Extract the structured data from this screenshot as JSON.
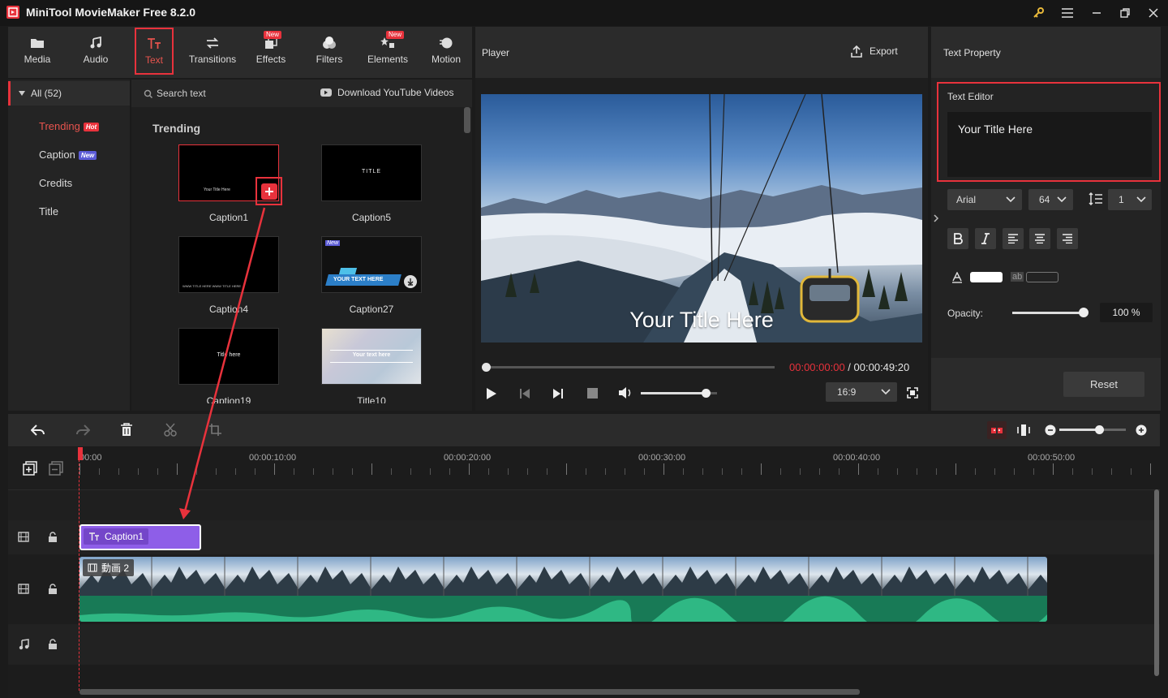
{
  "app": {
    "title": "MiniTool MovieMaker Free 8.2.0"
  },
  "toolbar": {
    "tabs": [
      {
        "label": "Media"
      },
      {
        "label": "Audio"
      },
      {
        "label": "Text"
      },
      {
        "label": "Transitions"
      },
      {
        "label": "Effects",
        "tag": "New"
      },
      {
        "label": "Filters"
      },
      {
        "label": "Elements",
        "tag": "New"
      },
      {
        "label": "Motion"
      }
    ]
  },
  "categories": {
    "all": "All (52)",
    "items": [
      {
        "label": "Trending",
        "badge": "Hot",
        "badge_color": "#e8323c"
      },
      {
        "label": "Caption",
        "badge": "New",
        "badge_color": "#5b5bd6"
      },
      {
        "label": "Credits"
      },
      {
        "label": "Title"
      }
    ]
  },
  "library": {
    "search_placeholder": "Search text",
    "download_link": "Download YouTube Videos",
    "section_title": "Trending",
    "items": [
      {
        "label": "Caption1",
        "preview": "Your Title Here"
      },
      {
        "label": "Caption5",
        "preview": "TITLE"
      },
      {
        "label": "Caption4",
        "preview": "WWW TITLE HERE WWW TITLE HERE"
      },
      {
        "label": "Caption27",
        "preview": "YOUR TEXT HERE",
        "tag": "New"
      },
      {
        "label": "Caption19",
        "preview": "Title here"
      },
      {
        "label": "Title10",
        "preview": "Your text here"
      }
    ]
  },
  "player": {
    "title": "Player",
    "export_label": "Export",
    "overlay_text": "Your Title Here",
    "time_current": "00:00:00:00",
    "time_separator": " / ",
    "time_total": "00:00:49:20",
    "aspect": "16:9",
    "progress": 0,
    "volume": 0.85
  },
  "text_property": {
    "title": "Text Property",
    "editor_label": "Text Editor",
    "editor_value": "Your Title Here",
    "font": "Arial",
    "size": "64",
    "line_spacing": "1",
    "opacity_label": "Opacity:",
    "opacity_value": "100 %",
    "opacity": 1.0,
    "text_color": "#ffffff",
    "bg_label": "ab",
    "reset_label": "Reset"
  },
  "timeline": {
    "zoom": 0.6,
    "ruler": [
      "00:00",
      "00:00:10:00",
      "00:00:20:00",
      "00:00:30:00",
      "00:00:40:00",
      "00:00:50:00"
    ],
    "text_clip": "Caption1",
    "video_clip": "動画 2"
  },
  "colors": {
    "accent": "#e8323c",
    "text_clip": "#8e5ee8",
    "audio_wave": "#2fb884"
  }
}
